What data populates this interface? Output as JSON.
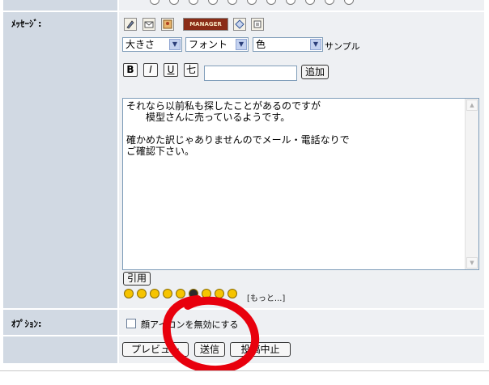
{
  "labels": {
    "message": "ﾒｯｾｰｼﾞ:",
    "option": "ｵﾌﾟｼｮﾝ:"
  },
  "toolbar": {
    "icons": [
      "tag-pen-icon",
      "email-icon",
      "image-icon",
      "manager-icon",
      "diamond-link-icon",
      "print-icon"
    ],
    "manager_label": "MANAGER"
  },
  "selects": {
    "size": "大きさ",
    "font": "フォント",
    "color": "色",
    "sample": "サンプル"
  },
  "format_buttons": {
    "bold": "B",
    "italic": "I",
    "underline": "U",
    "strike": "七"
  },
  "add_button": "追加",
  "message_text": "それなら以前私も探したことがあるのですが\n　　模型さんに売っているようです。\n\n確かめた訳じゃありませんのでメール・電話なりで\nご確認下さい。",
  "quote_button": "引用",
  "emoticon_more": "[もっと...]",
  "option_checkbox_label": "顔アイコンを無効にする",
  "buttons": {
    "preview": "プレビュー",
    "send": "送信",
    "cancel": "投稿中止"
  },
  "annotation_color": "#e8000d"
}
